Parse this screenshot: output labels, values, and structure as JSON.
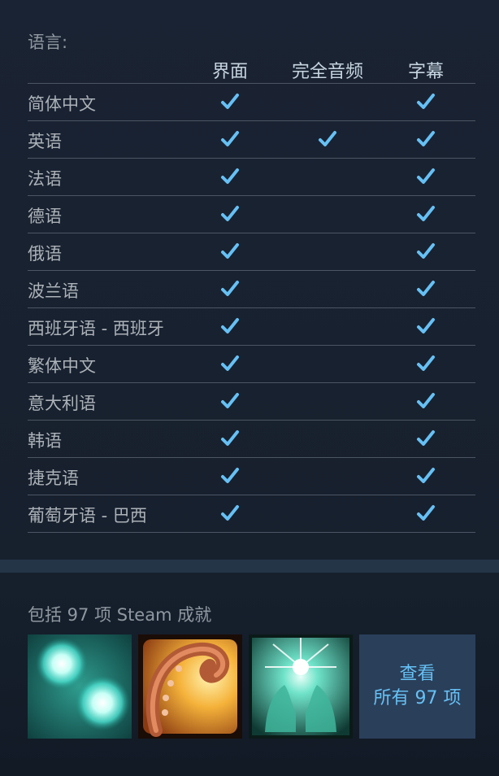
{
  "languages": {
    "label": "语言:",
    "columns": [
      "界面",
      "完全音频",
      "字幕"
    ],
    "check_color": "#66c0f4",
    "rows": [
      {
        "name": "简体中文",
        "interface": true,
        "audio": false,
        "subtitles": true
      },
      {
        "name": "英语",
        "interface": true,
        "audio": true,
        "subtitles": true
      },
      {
        "name": "法语",
        "interface": true,
        "audio": false,
        "subtitles": true
      },
      {
        "name": "德语",
        "interface": true,
        "audio": false,
        "subtitles": true
      },
      {
        "name": "俄语",
        "interface": true,
        "audio": false,
        "subtitles": true
      },
      {
        "name": "波兰语",
        "interface": true,
        "audio": false,
        "subtitles": true
      },
      {
        "name": "西班牙语 - 西班牙",
        "interface": true,
        "audio": false,
        "subtitles": true
      },
      {
        "name": "繁体中文",
        "interface": true,
        "audio": false,
        "subtitles": true
      },
      {
        "name": "意大利语",
        "interface": true,
        "audio": false,
        "subtitles": true
      },
      {
        "name": "韩语",
        "interface": true,
        "audio": false,
        "subtitles": true
      },
      {
        "name": "捷克语",
        "interface": true,
        "audio": false,
        "subtitles": true
      },
      {
        "name": "葡萄牙语 - 巴西",
        "interface": true,
        "audio": false,
        "subtitles": true
      }
    ]
  },
  "achievements": {
    "title": "包括 97 项 Steam 成就",
    "icons": [
      "glowing-orbs-icon",
      "tentacle-icon",
      "radiant-hands-icon"
    ],
    "view_all_line1": "查看",
    "view_all_line2": "所有 97 项"
  }
}
